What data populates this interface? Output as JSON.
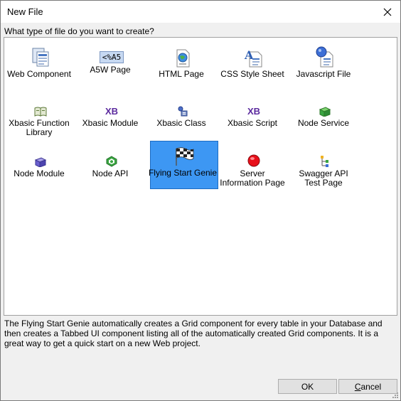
{
  "window": {
    "title": "New File"
  },
  "prompt": "What type of file do you want to create?",
  "items": [
    {
      "label": "Web Component",
      "icon": "web-component-icon"
    },
    {
      "label": "A5W Page",
      "icon": "a5w-page-icon",
      "icon_text": "<%A5"
    },
    {
      "label": "HTML Page",
      "icon": "html-page-icon"
    },
    {
      "label": "CSS Style Sheet",
      "icon": "css-style-sheet-icon"
    },
    {
      "label": "Javascript File",
      "icon": "javascript-file-icon"
    },
    {
      "label": "Xbasic Function\nLibrary",
      "icon": "xbasic-function-library-icon"
    },
    {
      "label": "Xbasic Module",
      "icon": "xbasic-module-icon",
      "icon_text": "XB"
    },
    {
      "label": "Xbasic Class",
      "icon": "xbasic-class-icon"
    },
    {
      "label": "Xbasic Script",
      "icon": "xbasic-script-icon",
      "icon_text": "XB"
    },
    {
      "label": "Node Service",
      "icon": "node-service-icon"
    },
    {
      "label": "Node Module",
      "icon": "node-module-icon"
    },
    {
      "label": "Node API",
      "icon": "node-api-icon"
    },
    {
      "label": "Flying Start Genie",
      "icon": "checkered-flag-icon",
      "selected": true
    },
    {
      "label": "Server\nInformation Page",
      "icon": "server-information-icon"
    },
    {
      "label": "Swagger API\nTest Page",
      "icon": "swagger-api-icon"
    }
  ],
  "description": "The Flying Start Genie automatically creates a Grid component for every table in your Database and then creates a Tabbed UI component listing all of the automatically created Grid components. It is a great way to get a quick start on a new Web project.",
  "buttons": {
    "ok": "OK",
    "cancel_first": "C",
    "cancel_rest": "ancel"
  },
  "colors": {
    "selection": "#3d97f3",
    "xbasic_purple": "#5b2a9e",
    "red_ball": "#e8101a",
    "green": "#3aa641"
  }
}
